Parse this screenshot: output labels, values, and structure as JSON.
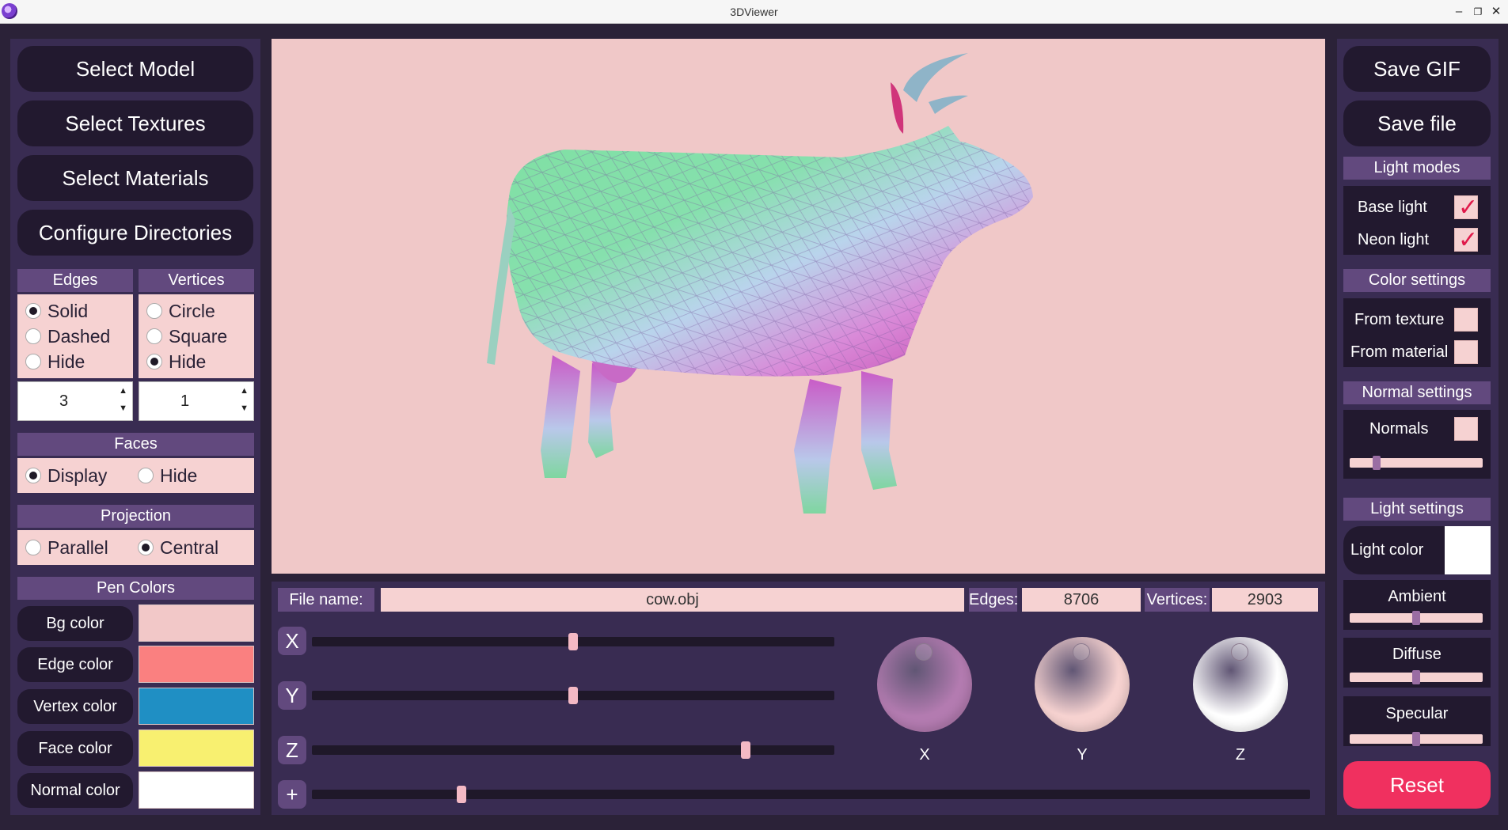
{
  "window": {
    "title": "3DViewer",
    "minimize": "–",
    "restore": "❐",
    "close": "✕"
  },
  "left": {
    "buttons": [
      "Select Model",
      "Select Textures",
      "Select Materials",
      "Configure Directories"
    ],
    "edges": {
      "header": "Edges",
      "options": [
        "Solid",
        "Dashed",
        "Hide"
      ],
      "selected": "Solid",
      "spin_value": "3"
    },
    "vertices": {
      "header": "Vertices",
      "options": [
        "Circle",
        "Square",
        "Hide"
      ],
      "selected": "Hide",
      "spin_value": "1"
    },
    "faces": {
      "header": "Faces",
      "options": [
        "Display",
        "Hide"
      ],
      "selected": "Display"
    },
    "projection": {
      "header": "Projection",
      "options": [
        "Parallel",
        "Central"
      ],
      "selected": "Central"
    },
    "pen_colors": {
      "header": "Pen Colors",
      "items": [
        {
          "label": "Bg color",
          "color": "#f2c8c8"
        },
        {
          "label": "Edge color",
          "color": "#fa8080"
        },
        {
          "label": "Vertex color",
          "color": "#1f8fc4"
        },
        {
          "label": "Face color",
          "color": "#f8f070"
        },
        {
          "label": "Normal color",
          "color": "#ffffff"
        }
      ]
    }
  },
  "bottom": {
    "file_label": "File name:",
    "file_name": "cow.obj",
    "edges_label": "Edges:",
    "edges_count": "8706",
    "vertices_label": "Vertices:",
    "vertices_count": "2903",
    "sliders": [
      {
        "axis": "X",
        "value": 0.5
      },
      {
        "axis": "Y",
        "value": 0.5
      },
      {
        "axis": "Z",
        "value": 0.83
      },
      {
        "axis": "+",
        "value": 0.15
      }
    ],
    "dials": [
      {
        "label": "X",
        "color": "#b37bb0"
      },
      {
        "label": "Y",
        "color": "#f6d2d0"
      },
      {
        "label": "Z",
        "color": "#ffffff"
      }
    ]
  },
  "right": {
    "save_gif": "Save GIF",
    "save_file": "Save file",
    "light_modes": {
      "header": "Light modes",
      "items": [
        {
          "label": "Base light",
          "checked": true
        },
        {
          "label": "Neon light",
          "checked": true
        }
      ]
    },
    "color_settings": {
      "header": "Color settings",
      "items": [
        {
          "label": "From texture",
          "checked": false
        },
        {
          "label": "From material",
          "checked": false
        }
      ]
    },
    "normal_settings": {
      "header": "Normal settings",
      "normals_label": "Normals",
      "normals_checked": false,
      "slider_value": 0.2
    },
    "light_settings": {
      "header": "Light settings",
      "light_color_label": "Light color",
      "light_color": "#ffffff"
    },
    "ambient": {
      "label": "Ambient",
      "value": 0.5
    },
    "diffuse": {
      "label": "Diffuse",
      "value": 0.5
    },
    "specular": {
      "label": "Specular",
      "value": 0.5
    },
    "reset": "Reset"
  }
}
